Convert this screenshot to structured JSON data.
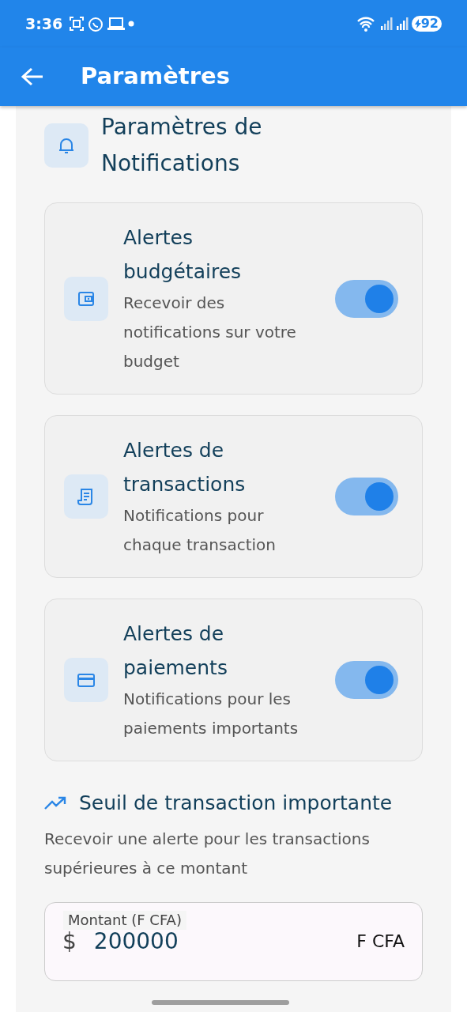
{
  "status_bar": {
    "time": "3:36",
    "battery": "92"
  },
  "app_bar": {
    "title": "Paramètres"
  },
  "section": {
    "title": "Paramètres de Notifications"
  },
  "alerts": [
    {
      "kind": "wallet",
      "title": "Alertes budgétaires",
      "description": "Recevoir des notifications sur votre budget",
      "on": true
    },
    {
      "kind": "receipt",
      "title": "Alertes de transactions",
      "description": "Notifications pour chaque transaction",
      "on": true
    },
    {
      "kind": "card",
      "title": "Alertes de paiements",
      "description": "Notifications pour les paiements importants",
      "on": true
    }
  ],
  "threshold": {
    "title": "Seuil de transaction importante",
    "description": "Recevoir une alerte pour les transactions supérieures à ce montant",
    "field": {
      "label": "Montant (F CFA)",
      "prefix": "$",
      "value": "200000",
      "suffix": "F CFA"
    }
  }
}
